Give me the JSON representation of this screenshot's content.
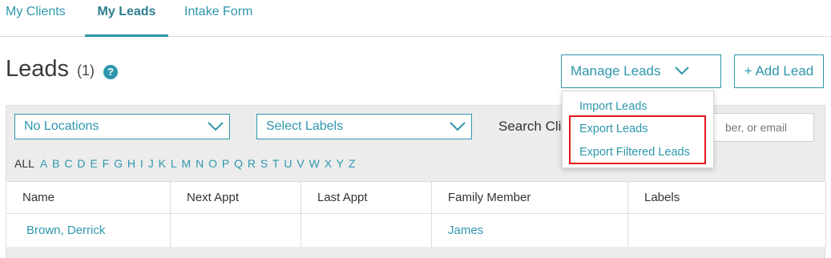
{
  "tabs": [
    {
      "label": "My Clients"
    },
    {
      "label": "My Leads"
    },
    {
      "label": "Intake Form"
    }
  ],
  "header": {
    "title": "Leads",
    "count": "(1)",
    "help_icon": "?",
    "manage_label": "Manage Leads",
    "add_label": "+ Add Lead"
  },
  "filters": {
    "locations": "No Locations",
    "labels": "Select Labels",
    "search_label": "Search Clients",
    "search_placeholder": "ber, or email",
    "all_label": "ALL",
    "letters": [
      "A",
      "B",
      "C",
      "D",
      "E",
      "F",
      "G",
      "H",
      "I",
      "J",
      "K",
      "L",
      "M",
      "N",
      "O",
      "P",
      "Q",
      "R",
      "S",
      "T",
      "U",
      "V",
      "W",
      "X",
      "Y",
      "Z"
    ]
  },
  "table": {
    "columns": [
      "Name",
      "Next Appt",
      "Last Appt",
      "Family Member",
      "Labels"
    ],
    "rows": [
      {
        "name": "Brown, Derrick",
        "next_appt": "",
        "last_appt": "",
        "family_member": "James",
        "labels": ""
      }
    ]
  },
  "menu": {
    "items": [
      "Import Leads",
      "Export Leads",
      "Export Filtered Leads"
    ]
  },
  "colors": {
    "accent": "#2e97ac",
    "highlight": "#e8161b",
    "panel": "#ececec"
  },
  "icons": {
    "help": "question-circle-icon",
    "chevron": "chevron-down-icon"
  }
}
